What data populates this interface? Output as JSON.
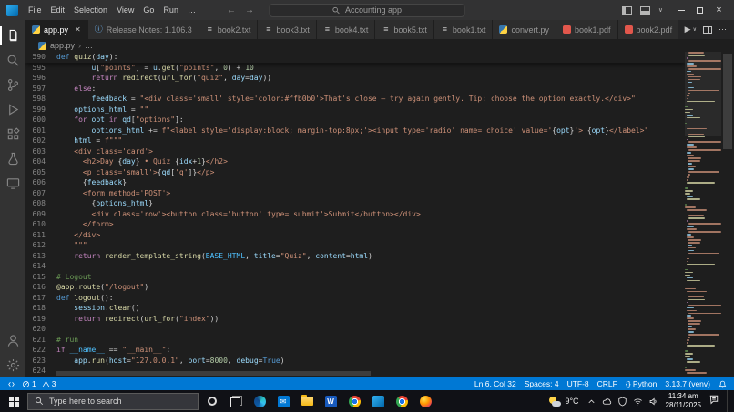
{
  "titlebar": {
    "menus": [
      "File",
      "Edit",
      "Selection",
      "View",
      "Go",
      "Run",
      "…"
    ],
    "search_value": "Accounting app"
  },
  "tabs": [
    {
      "label": "app.py",
      "icon": "python",
      "active": true
    },
    {
      "label": "Release Notes: 1.106.3",
      "icon": "info"
    },
    {
      "label": "book2.txt",
      "icon": "txt"
    },
    {
      "label": "book3.txt",
      "icon": "txt"
    },
    {
      "label": "book4.txt",
      "icon": "txt"
    },
    {
      "label": "book5.txt",
      "icon": "txt"
    },
    {
      "label": "book1.txt",
      "icon": "txt"
    },
    {
      "label": "convert.py",
      "icon": "python"
    },
    {
      "label": "book1.pdf",
      "icon": "pdf"
    },
    {
      "label": "book2.pdf",
      "icon": "pdf"
    }
  ],
  "breadcrumb": {
    "file": "app.py",
    "more": "…"
  },
  "editor": {
    "sticky": {
      "n": 590,
      "t": [
        [
          "d",
          "def "
        ],
        [
          "f",
          "quiz"
        ],
        [
          "p",
          "("
        ],
        [
          "v",
          "day"
        ],
        [
          "p",
          "):"
        ]
      ]
    },
    "lines": [
      {
        "n": 595,
        "t": [
          [
            "p",
            "        "
          ],
          [
            "v",
            "u"
          ],
          [
            "p",
            "["
          ],
          [
            "s",
            "\"points\""
          ],
          [
            "p",
            "] = "
          ],
          [
            "v",
            "u"
          ],
          [
            "p",
            "."
          ],
          [
            "f",
            "get"
          ],
          [
            "p",
            "("
          ],
          [
            "s",
            "\"points\""
          ],
          [
            "p",
            ", "
          ],
          [
            "n",
            "0"
          ],
          [
            "p",
            ") + "
          ],
          [
            "n",
            "10"
          ]
        ]
      },
      {
        "n": 596,
        "t": [
          [
            "p",
            "        "
          ],
          [
            "k",
            "return "
          ],
          [
            "f",
            "redirect"
          ],
          [
            "p",
            "("
          ],
          [
            "f",
            "url_for"
          ],
          [
            "p",
            "("
          ],
          [
            "s",
            "\"quiz\""
          ],
          [
            "p",
            ", "
          ],
          [
            "v",
            "day"
          ],
          [
            "p",
            "="
          ],
          [
            "v",
            "day"
          ],
          [
            "p",
            "))"
          ]
        ]
      },
      {
        "n": 597,
        "t": [
          [
            "p",
            "    "
          ],
          [
            "k",
            "else"
          ],
          [
            "p",
            ":"
          ]
        ]
      },
      {
        "n": 598,
        "t": [
          [
            "p",
            "        "
          ],
          [
            "v",
            "feedback"
          ],
          [
            "p",
            " = "
          ],
          [
            "s",
            "\"<div class='small' style='color:#ffb0b0'>That's close — try again gently. Tip: choose the option exactly.</div>\""
          ]
        ]
      },
      {
        "n": 599,
        "t": [
          [
            "p",
            "    "
          ],
          [
            "v",
            "options_html"
          ],
          [
            "p",
            " = "
          ],
          [
            "s",
            "\"\""
          ]
        ]
      },
      {
        "n": 600,
        "t": [
          [
            "p",
            "    "
          ],
          [
            "k",
            "for "
          ],
          [
            "v",
            "opt"
          ],
          [
            "k",
            " in "
          ],
          [
            "v",
            "qd"
          ],
          [
            "p",
            "["
          ],
          [
            "s",
            "\"options\""
          ],
          [
            "p",
            "]:"
          ]
        ]
      },
      {
        "n": 601,
        "t": [
          [
            "p",
            "        "
          ],
          [
            "v",
            "options_html"
          ],
          [
            "p",
            " += "
          ],
          [
            "s",
            "f\"<label style='display:block; margin-top:8px;'><input type='radio' name='choice' value='"
          ],
          [
            "p",
            "{"
          ],
          [
            "v",
            "opt"
          ],
          [
            "p",
            "}"
          ],
          [
            "s",
            "'> "
          ],
          [
            "p",
            "{"
          ],
          [
            "v",
            "opt"
          ],
          [
            "p",
            "}"
          ],
          [
            "s",
            "</label>\""
          ]
        ]
      },
      {
        "n": 602,
        "t": [
          [
            "p",
            "    "
          ],
          [
            "v",
            "html"
          ],
          [
            "p",
            " = "
          ],
          [
            "s",
            "f\"\"\""
          ]
        ]
      },
      {
        "n": 603,
        "t": [
          [
            "s",
            "    <div class='card'>"
          ]
        ]
      },
      {
        "n": 604,
        "t": [
          [
            "s",
            "      <h2>Day "
          ],
          [
            "p",
            "{"
          ],
          [
            "v",
            "day"
          ],
          [
            "p",
            "}"
          ],
          [
            "s",
            " • Quiz "
          ],
          [
            "p",
            "{"
          ],
          [
            "v",
            "idx"
          ],
          [
            "p",
            "+"
          ],
          [
            "n",
            "1"
          ],
          [
            "p",
            "}"
          ],
          [
            "s",
            "</h2>"
          ]
        ]
      },
      {
        "n": 605,
        "t": [
          [
            "s",
            "      <p class='small'>"
          ],
          [
            "p",
            "{"
          ],
          [
            "v",
            "qd"
          ],
          [
            "p",
            "["
          ],
          [
            "s",
            "'q'"
          ],
          [
            "p",
            "]}"
          ],
          [
            "s",
            "</p>"
          ]
        ]
      },
      {
        "n": 606,
        "t": [
          [
            "s",
            "      "
          ],
          [
            "p",
            "{"
          ],
          [
            "v",
            "feedback"
          ],
          [
            "p",
            "}"
          ]
        ]
      },
      {
        "n": 607,
        "t": [
          [
            "s",
            "      <form method='POST'>"
          ]
        ]
      },
      {
        "n": 608,
        "t": [
          [
            "s",
            "        "
          ],
          [
            "p",
            "{"
          ],
          [
            "v",
            "options_html"
          ],
          [
            "p",
            "}"
          ]
        ]
      },
      {
        "n": 609,
        "t": [
          [
            "s",
            "        <div class='row'><button class='button' type='submit'>Submit</button></div>"
          ]
        ]
      },
      {
        "n": 610,
        "t": [
          [
            "s",
            "      </form>"
          ]
        ]
      },
      {
        "n": 611,
        "t": [
          [
            "s",
            "    </div>"
          ]
        ]
      },
      {
        "n": 612,
        "t": [
          [
            "s",
            "    \"\"\""
          ]
        ]
      },
      {
        "n": 613,
        "t": [
          [
            "p",
            "    "
          ],
          [
            "k",
            "return "
          ],
          [
            "f",
            "render_template_string"
          ],
          [
            "p",
            "("
          ],
          [
            "C",
            "BASE_HTML"
          ],
          [
            "p",
            ", "
          ],
          [
            "v",
            "title"
          ],
          [
            "p",
            "="
          ],
          [
            "s",
            "\"Quiz\""
          ],
          [
            "p",
            ", "
          ],
          [
            "v",
            "content"
          ],
          [
            "p",
            "="
          ],
          [
            "v",
            "html"
          ],
          [
            "p",
            ")"
          ]
        ]
      },
      {
        "n": 614,
        "t": []
      },
      {
        "n": 615,
        "t": [
          [
            "c",
            "# Logout"
          ]
        ]
      },
      {
        "n": 616,
        "t": [
          [
            "f",
            "@app.route"
          ],
          [
            "p",
            "("
          ],
          [
            "s",
            "\"/logout\""
          ],
          [
            "p",
            ")"
          ]
        ]
      },
      {
        "n": 617,
        "t": [
          [
            "d",
            "def "
          ],
          [
            "f",
            "logout"
          ],
          [
            "p",
            "():"
          ]
        ]
      },
      {
        "n": 618,
        "t": [
          [
            "p",
            "    "
          ],
          [
            "v",
            "session"
          ],
          [
            "p",
            "."
          ],
          [
            "f",
            "clear"
          ],
          [
            "p",
            "()"
          ]
        ]
      },
      {
        "n": 619,
        "t": [
          [
            "p",
            "    "
          ],
          [
            "k",
            "return "
          ],
          [
            "f",
            "redirect"
          ],
          [
            "p",
            "("
          ],
          [
            "f",
            "url_for"
          ],
          [
            "p",
            "("
          ],
          [
            "s",
            "\"index\""
          ],
          [
            "p",
            "))"
          ]
        ]
      },
      {
        "n": 620,
        "t": []
      },
      {
        "n": 621,
        "t": [
          [
            "c",
            "# run"
          ]
        ]
      },
      {
        "n": 622,
        "t": [
          [
            "k",
            "if "
          ],
          [
            "C",
            "__name__"
          ],
          [
            "p",
            " == "
          ],
          [
            "s",
            "\"__main__\""
          ],
          [
            "p",
            ":"
          ]
        ]
      },
      {
        "n": 623,
        "t": [
          [
            "p",
            "    "
          ],
          [
            "v",
            "app"
          ],
          [
            "p",
            "."
          ],
          [
            "f",
            "run"
          ],
          [
            "p",
            "("
          ],
          [
            "v",
            "host"
          ],
          [
            "p",
            "="
          ],
          [
            "s",
            "\"127.0.0.1\""
          ],
          [
            "p",
            ", "
          ],
          [
            "v",
            "port"
          ],
          [
            "p",
            "="
          ],
          [
            "n",
            "8000"
          ],
          [
            "p",
            ", "
          ],
          [
            "v",
            "debug"
          ],
          [
            "p",
            "="
          ],
          [
            "d",
            "True"
          ],
          [
            "p",
            ")"
          ]
        ]
      },
      {
        "n": 624,
        "t": []
      }
    ]
  },
  "statusbar": {
    "errors": "1",
    "warnings": "3",
    "right": [
      "Ln 6, Col 32",
      "Spaces: 4",
      "UTF-8",
      "CRLF",
      "{} Python",
      "3.13.7 (venv)"
    ]
  },
  "activity_bar": {
    "items": [
      "explorer",
      "search",
      "source-control",
      "run-debug",
      "extensions",
      "testing",
      "remote-explorer"
    ],
    "bottom_items": [
      "account",
      "settings"
    ]
  },
  "taskbar": {
    "search_placeholder": "Type here to search",
    "icons": [
      "cortana",
      "task-view",
      "edge",
      "mail",
      "file-explorer",
      "word",
      "chrome",
      "vscode",
      "chrome",
      "firefox"
    ],
    "weather": "9°C",
    "time": "11:34 am",
    "date": "28/11/2025"
  },
  "icons": {
    "python-icon": "blue-yellow gradient square",
    "txt-icon": "≡",
    "info-icon": "ⓘ",
    "pdf-icon": "red square",
    "search-icon": "magnifier",
    "close-icon": "✕",
    "run-icon": "▶",
    "more-icon": "⋯"
  }
}
